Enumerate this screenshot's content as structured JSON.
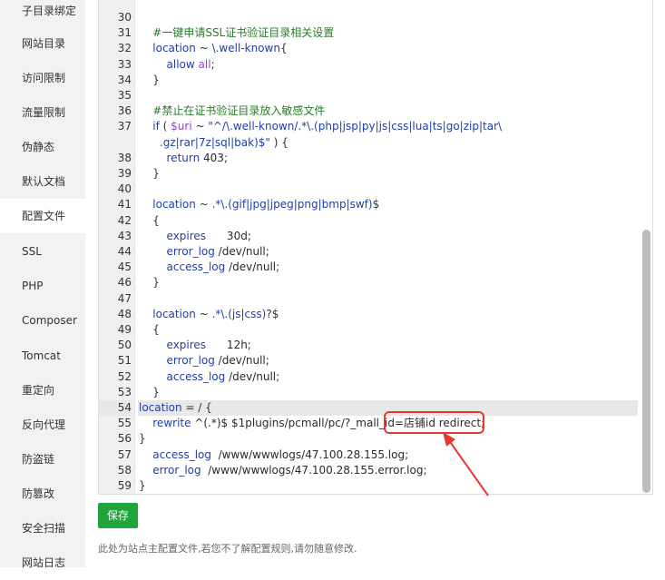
{
  "sidebar": {
    "items": [
      {
        "label": "子目录绑定",
        "active": false
      },
      {
        "label": "网站目录",
        "active": false
      },
      {
        "label": "访问限制",
        "active": false
      },
      {
        "label": "流量限制",
        "active": false
      },
      {
        "label": "伪静态",
        "active": false
      },
      {
        "label": "默认文档",
        "active": false
      },
      {
        "label": "配置文件",
        "active": true
      },
      {
        "label": "SSL",
        "active": false
      },
      {
        "label": "PHP",
        "active": false
      },
      {
        "label": "Composer",
        "active": false
      },
      {
        "label": "Tomcat",
        "active": false
      },
      {
        "label": "重定向",
        "active": false
      },
      {
        "label": "反向代理",
        "active": false
      },
      {
        "label": "防盗链",
        "active": false
      },
      {
        "label": "防篡改",
        "active": false
      },
      {
        "label": "安全扫描",
        "active": false
      },
      {
        "label": "网站日志",
        "active": false
      }
    ]
  },
  "editor": {
    "lines": [
      {
        "num": "30",
        "segs": []
      },
      {
        "num": "31",
        "segs": [
          [
            "    ",
            ""
          ],
          [
            "#一键申请SSL证书验证目录相关设置",
            "c-comment"
          ]
        ]
      },
      {
        "num": "32",
        "segs": [
          [
            "    ",
            ""
          ],
          [
            "location",
            "c-kw"
          ],
          [
            " ~ ",
            "c-op"
          ],
          [
            "\\.well-known",
            "c-str"
          ],
          [
            "{",
            "c-op"
          ]
        ]
      },
      {
        "num": "33",
        "segs": [
          [
            "        ",
            ""
          ],
          [
            "allow",
            "c-kw"
          ],
          [
            " ",
            ""
          ],
          [
            "all",
            "c-val"
          ],
          [
            ";",
            "c-op"
          ]
        ]
      },
      {
        "num": "34",
        "segs": [
          [
            "    }",
            "c-op"
          ]
        ]
      },
      {
        "num": "35",
        "segs": []
      },
      {
        "num": "36",
        "segs": [
          [
            "    ",
            ""
          ],
          [
            "#禁止在证书验证目录放入敏感文件",
            "c-comment"
          ]
        ]
      },
      {
        "num": "37",
        "segs": [
          [
            "    ",
            ""
          ],
          [
            "if",
            "c-kw"
          ],
          [
            " ( ",
            "c-op"
          ],
          [
            "$uri",
            "c-var"
          ],
          [
            " ~ ",
            "c-op"
          ],
          [
            "\"^/\\.well-known/.*\\.(php|jsp|py|js|css|lua|ts|go|zip|tar\\",
            "c-str"
          ]
        ]
      },
      {
        "num": "",
        "segs": [
          [
            "      ",
            ""
          ],
          [
            ".gz|rar|7z|sql|bak)$\"",
            "c-str"
          ],
          [
            " ) {",
            "c-op"
          ]
        ]
      },
      {
        "num": "38",
        "segs": [
          [
            "        ",
            ""
          ],
          [
            "return",
            "c-kw"
          ],
          [
            " 403;",
            "c-num"
          ]
        ]
      },
      {
        "num": "39",
        "segs": [
          [
            "    }",
            "c-op"
          ]
        ]
      },
      {
        "num": "40",
        "segs": []
      },
      {
        "num": "41",
        "segs": [
          [
            "    ",
            ""
          ],
          [
            "location",
            "c-kw"
          ],
          [
            " ~ ",
            "c-op"
          ],
          [
            ".*\\.(gif|jpg|jpeg|png|bmp|swf)",
            "c-str"
          ],
          [
            "$",
            "c-op"
          ]
        ]
      },
      {
        "num": "42",
        "segs": [
          [
            "    {",
            "c-op"
          ]
        ]
      },
      {
        "num": "43",
        "segs": [
          [
            "        ",
            ""
          ],
          [
            "expires",
            "c-kw"
          ],
          [
            "      30d;",
            "c-num"
          ]
        ]
      },
      {
        "num": "44",
        "segs": [
          [
            "        ",
            ""
          ],
          [
            "error_log",
            "c-kw"
          ],
          [
            " /dev/null;",
            "c-num"
          ]
        ]
      },
      {
        "num": "45",
        "segs": [
          [
            "        ",
            ""
          ],
          [
            "access_log",
            "c-kw"
          ],
          [
            " /dev/null;",
            "c-num"
          ]
        ]
      },
      {
        "num": "46",
        "segs": [
          [
            "    }",
            "c-op"
          ]
        ]
      },
      {
        "num": "47",
        "segs": []
      },
      {
        "num": "48",
        "segs": [
          [
            "    ",
            ""
          ],
          [
            "location",
            "c-kw"
          ],
          [
            " ~ ",
            "c-op"
          ],
          [
            ".*\\.(js|css)",
            "c-str"
          ],
          [
            "?$",
            "c-op"
          ]
        ]
      },
      {
        "num": "49",
        "segs": [
          [
            "    {",
            "c-op"
          ]
        ]
      },
      {
        "num": "50",
        "segs": [
          [
            "        ",
            ""
          ],
          [
            "expires",
            "c-kw"
          ],
          [
            "      12h;",
            "c-num"
          ]
        ]
      },
      {
        "num": "51",
        "segs": [
          [
            "        ",
            ""
          ],
          [
            "error_log",
            "c-kw"
          ],
          [
            " /dev/null;",
            "c-num"
          ]
        ]
      },
      {
        "num": "52",
        "segs": [
          [
            "        ",
            ""
          ],
          [
            "access_log",
            "c-kw"
          ],
          [
            " /dev/null;",
            "c-num"
          ]
        ]
      },
      {
        "num": "53",
        "segs": [
          [
            "    }",
            "c-op"
          ]
        ]
      },
      {
        "num": "54",
        "segs": [
          [
            "location",
            "c-kw"
          ],
          [
            " = / {",
            "c-op"
          ]
        ],
        "highlight": true
      },
      {
        "num": "55",
        "segs": [
          [
            "    ",
            ""
          ],
          [
            "rewrite",
            "c-kw"
          ],
          [
            " ^(.*)$ $1plugins/pcmall/pc/?_mall_id=店铺id redirect;",
            "c-num"
          ]
        ]
      },
      {
        "num": "56",
        "segs": [
          [
            "}",
            "c-op"
          ]
        ]
      },
      {
        "num": "57",
        "segs": [
          [
            "    ",
            ""
          ],
          [
            "access_log",
            "c-kw"
          ],
          [
            "  /www/wwwlogs/47.100.28.155.log;",
            "c-num"
          ]
        ]
      },
      {
        "num": "58",
        "segs": [
          [
            "    ",
            ""
          ],
          [
            "error_log",
            "c-kw"
          ],
          [
            "  /www/wwwlogs/47.100.28.155.error.log;",
            "c-num"
          ]
        ]
      },
      {
        "num": "59",
        "segs": [
          [
            "}",
            "c-op"
          ]
        ]
      }
    ]
  },
  "annotation_color": "#e8392f",
  "save_label": "保存",
  "note": "此处为站点主配置文件,若您不了解配置规则,请勿随意修改."
}
